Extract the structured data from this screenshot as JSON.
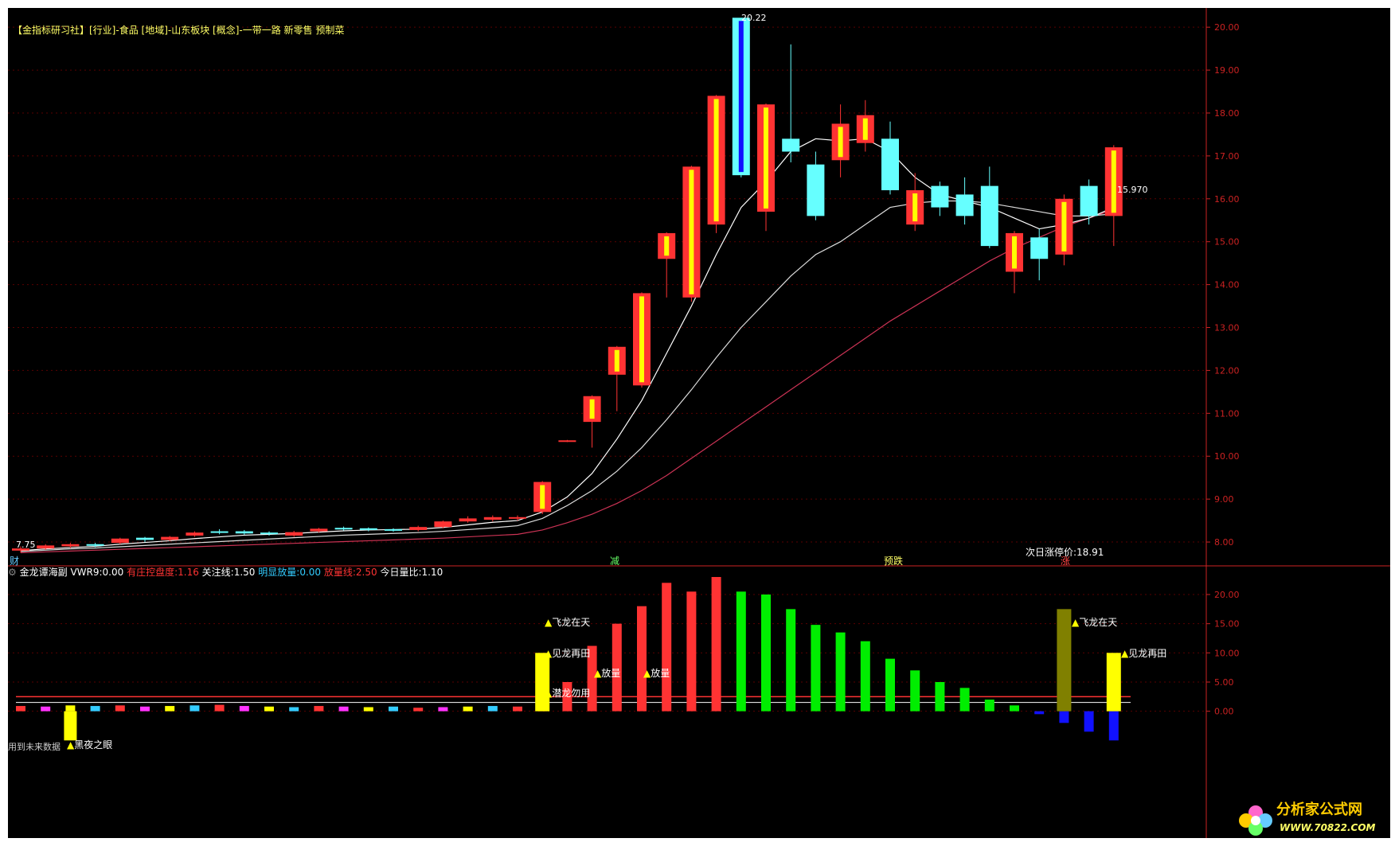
{
  "main_panel": {
    "header": "【金指标研习社】[行业]-食品 [地域]-山东板块 [概念]-一带一路 新零售 预制菜",
    "high_label": "20.22",
    "low_label": "7.75",
    "last_price_label": "15.970",
    "limit_price_text": "次日涨停价:18.91",
    "left_bottom_marker": "财",
    "bottom_markers": [
      "减",
      "预跌",
      "涨"
    ]
  },
  "sub_panel": {
    "title": "金龙谭海副",
    "params": [
      {
        "label": "VWR9:",
        "value": "0.00",
        "color": "#ffffff"
      },
      {
        "label": "有庄控盘度:",
        "value": "1.16",
        "color": "#ff3333"
      },
      {
        "label": "关注线:",
        "value": "1.50",
        "color": "#ffffff"
      },
      {
        "label": "明显放量:",
        "value": "0.00",
        "color": "#33ccff"
      },
      {
        "label": "放量线:",
        "value": "2.50",
        "color": "#ff3333"
      },
      {
        "label": "今日量比:",
        "value": "1.10",
        "color": "#ffffff"
      }
    ],
    "footer_text": "用到未来数据",
    "signals": {
      "hei_ye": "黑夜之眼",
      "fei_long_1": "飞龙在天",
      "jian_long_1": "见龙再田",
      "qian_long": "潜龙勿用",
      "fang_liang_1": "放量",
      "fang_liang_2": "放量",
      "fei_long_2": "飞龙在天",
      "jian_long_2": "见龙再田"
    }
  },
  "watermark": {
    "title": "分析家公式网",
    "url": "WWW.70822.COM"
  },
  "colors": {
    "background": "#000000",
    "up": "#ff3333",
    "down": "#66ffff",
    "axis": "#cc2222",
    "volume_green": "#00ee00",
    "volume_blue": "#1111ff",
    "signal_yellow": "#ffff00",
    "gridline": "#5a0000"
  },
  "chart_data": [
    {
      "type": "candlestick",
      "y_ticks": [
        "20.00",
        "19.00",
        "18.00",
        "17.00",
        "16.00",
        "15.00",
        "14.00",
        "13.00",
        "12.00",
        "11.00",
        "10.00",
        "9.00",
        "8.00"
      ],
      "ylim": [
        7.5,
        20.3
      ],
      "candles": [
        {
          "o": 7.8,
          "c": 7.85,
          "h": 7.9,
          "l": 7.75
        },
        {
          "o": 7.85,
          "c": 7.92,
          "h": 7.95,
          "l": 7.82
        },
        {
          "o": 7.9,
          "c": 7.95,
          "h": 7.98,
          "l": 7.86
        },
        {
          "o": 7.95,
          "c": 7.93,
          "h": 7.98,
          "l": 7.88
        },
        {
          "o": 7.98,
          "c": 8.08,
          "h": 8.1,
          "l": 7.95
        },
        {
          "o": 8.1,
          "c": 8.05,
          "h": 8.12,
          "l": 8.0
        },
        {
          "o": 8.05,
          "c": 8.12,
          "h": 8.14,
          "l": 8.02
        },
        {
          "o": 8.15,
          "c": 8.22,
          "h": 8.25,
          "l": 8.12
        },
        {
          "o": 8.25,
          "c": 8.23,
          "h": 8.3,
          "l": 8.18
        },
        {
          "o": 8.25,
          "c": 8.2,
          "h": 8.28,
          "l": 8.17
        },
        {
          "o": 8.22,
          "c": 8.19,
          "h": 8.25,
          "l": 8.15
        },
        {
          "o": 8.15,
          "c": 8.23,
          "h": 8.26,
          "l": 8.12
        },
        {
          "o": 8.25,
          "c": 8.31,
          "h": 8.33,
          "l": 8.22
        },
        {
          "o": 8.33,
          "c": 8.3,
          "h": 8.36,
          "l": 8.27
        },
        {
          "o": 8.32,
          "c": 8.28,
          "h": 8.34,
          "l": 8.25
        },
        {
          "o": 8.3,
          "c": 8.27,
          "h": 8.32,
          "l": 8.24
        },
        {
          "o": 8.28,
          "c": 8.35,
          "h": 8.38,
          "l": 8.25
        },
        {
          "o": 8.35,
          "c": 8.48,
          "h": 8.5,
          "l": 8.32
        },
        {
          "o": 8.48,
          "c": 8.55,
          "h": 8.6,
          "l": 8.45
        },
        {
          "o": 8.52,
          "c": 8.58,
          "h": 8.62,
          "l": 8.48
        },
        {
          "o": 8.55,
          "c": 8.58,
          "h": 8.62,
          "l": 8.5
        },
        {
          "o": 8.7,
          "c": 9.4,
          "h": 9.42,
          "l": 8.65
        },
        {
          "o": 10.35,
          "c": 10.37,
          "h": 10.38,
          "l": 10.33
        },
        {
          "o": 10.8,
          "c": 11.4,
          "h": 11.42,
          "l": 10.2
        },
        {
          "o": 11.9,
          "c": 12.55,
          "h": 12.57,
          "l": 11.05
        },
        {
          "o": 11.65,
          "c": 13.8,
          "h": 13.82,
          "l": 11.6
        },
        {
          "o": 14.6,
          "c": 15.2,
          "h": 15.22,
          "l": 13.7
        },
        {
          "o": 13.7,
          "c": 16.75,
          "h": 16.77,
          "l": 13.6
        },
        {
          "o": 15.4,
          "c": 18.4,
          "h": 18.42,
          "l": 15.2
        },
        {
          "o": 20.22,
          "c": 16.55,
          "h": 20.22,
          "l": 16.5
        },
        {
          "o": 15.7,
          "c": 18.2,
          "h": 18.22,
          "l": 15.25
        },
        {
          "o": 17.4,
          "c": 17.1,
          "h": 19.6,
          "l": 16.85
        },
        {
          "o": 16.8,
          "c": 15.6,
          "h": 17.1,
          "l": 15.5
        },
        {
          "o": 16.9,
          "c": 17.75,
          "h": 18.2,
          "l": 16.5
        },
        {
          "o": 17.3,
          "c": 17.95,
          "h": 18.3,
          "l": 17.1
        },
        {
          "o": 17.4,
          "c": 16.2,
          "h": 17.8,
          "l": 16.1
        },
        {
          "o": 15.4,
          "c": 16.2,
          "h": 16.6,
          "l": 15.25
        },
        {
          "o": 16.3,
          "c": 15.8,
          "h": 16.4,
          "l": 15.6
        },
        {
          "o": 16.1,
          "c": 15.6,
          "h": 16.5,
          "l": 15.4
        },
        {
          "o": 16.3,
          "c": 14.9,
          "h": 16.75,
          "l": 14.85
        },
        {
          "o": 14.3,
          "c": 15.2,
          "h": 15.25,
          "l": 13.8
        },
        {
          "o": 15.1,
          "c": 14.6,
          "h": 15.3,
          "l": 14.1
        },
        {
          "o": 14.7,
          "c": 16.0,
          "h": 16.1,
          "l": 14.45
        },
        {
          "o": 16.3,
          "c": 15.6,
          "h": 16.45,
          "l": 15.4
        },
        {
          "o": 15.6,
          "c": 17.2,
          "h": 17.25,
          "l": 14.9
        }
      ],
      "ma_fast": [
        7.8,
        7.84,
        7.87,
        7.9,
        7.95,
        7.99,
        8.03,
        8.08,
        8.12,
        8.16,
        8.18,
        8.2,
        8.23,
        8.26,
        8.28,
        8.29,
        8.3,
        8.34,
        8.4,
        8.46,
        8.5,
        8.7,
        9.05,
        9.6,
        10.4,
        11.3,
        12.4,
        13.5,
        14.7,
        15.8,
        16.4,
        17.1,
        17.4,
        17.35,
        17.4,
        17.1,
        16.5,
        16.1,
        15.95,
        15.8,
        15.55,
        15.3,
        15.4,
        15.55,
        15.8
      ],
      "ma_mid": [
        7.78,
        7.81,
        7.84,
        7.86,
        7.89,
        7.92,
        7.95,
        7.98,
        8.01,
        8.04,
        8.07,
        8.1,
        8.13,
        8.16,
        8.18,
        8.2,
        8.22,
        8.25,
        8.29,
        8.33,
        8.38,
        8.55,
        8.85,
        9.2,
        9.65,
        10.2,
        10.85,
        11.55,
        12.3,
        13.0,
        13.6,
        14.2,
        14.7,
        15.0,
        15.4,
        15.8,
        15.9,
        15.95,
        15.95,
        15.9,
        15.8,
        15.7,
        15.6,
        15.6,
        15.65
      ],
      "ma_slow": [
        7.75,
        7.77,
        7.79,
        7.81,
        7.83,
        7.85,
        7.87,
        7.89,
        7.91,
        7.93,
        7.95,
        7.97,
        7.99,
        8.01,
        8.03,
        8.05,
        8.07,
        8.09,
        8.12,
        8.15,
        8.18,
        8.28,
        8.45,
        8.65,
        8.9,
        9.2,
        9.55,
        9.95,
        10.35,
        10.75,
        11.15,
        11.55,
        11.95,
        12.35,
        12.75,
        13.15,
        13.5,
        13.85,
        14.2,
        14.55,
        14.85,
        15.1,
        15.35,
        15.55,
        15.75
      ]
    },
    {
      "type": "bar",
      "y_ticks": [
        "20.00",
        "15.00",
        "10.00",
        "5.00",
        "0.00"
      ],
      "ylim": [
        -7,
        23
      ],
      "bars": [
        0.9,
        0.8,
        1.0,
        0.9,
        1.0,
        0.8,
        0.9,
        1.0,
        1.1,
        0.9,
        0.8,
        0.7,
        0.9,
        0.8,
        0.7,
        0.8,
        0.6,
        0.7,
        0.8,
        0.9,
        0.8,
        4.3,
        5.0,
        11.2,
        15.0,
        18.0,
        22.0,
        20.5,
        23.0,
        20.5,
        20.0,
        17.5,
        14.8,
        13.5,
        12.0,
        9.0,
        7.0,
        5.0,
        4.0,
        2.0,
        1.0,
        -0.5,
        -2.0,
        -3.5,
        -5.0
      ]
    }
  ]
}
